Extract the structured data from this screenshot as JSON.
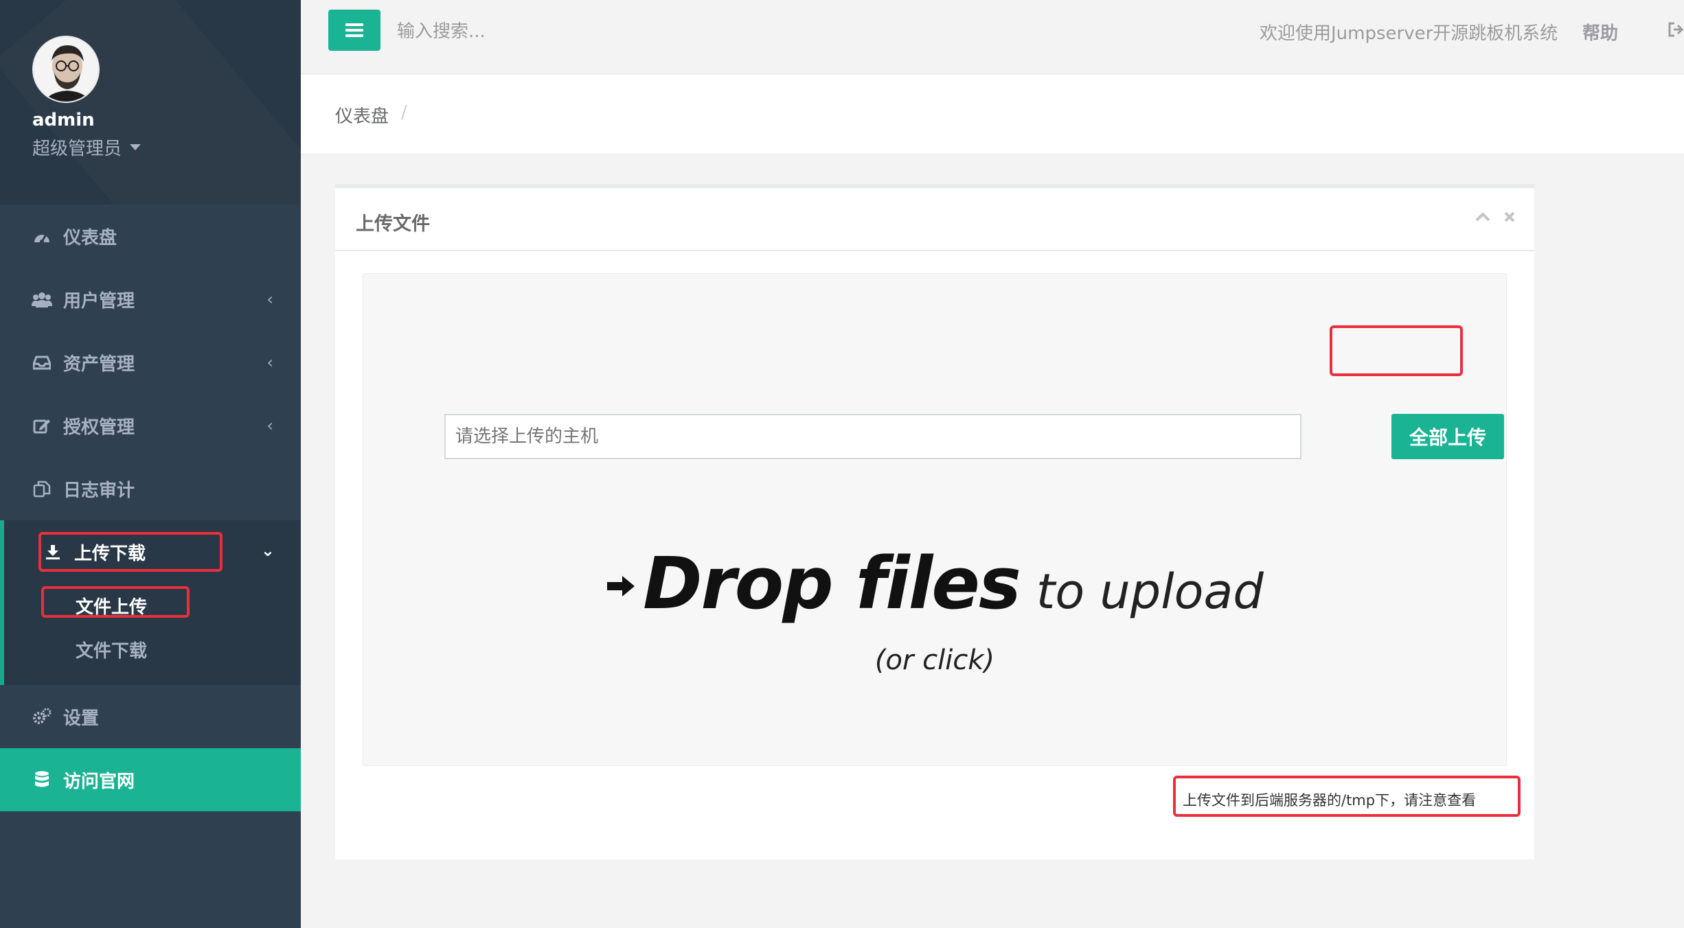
{
  "profile": {
    "name": "admin",
    "role": "超级管理员"
  },
  "nav": {
    "items": [
      {
        "label": "仪表盘",
        "icon": "dashboard-icon"
      },
      {
        "label": "用户管理",
        "icon": "users-icon"
      },
      {
        "label": "资产管理",
        "icon": "inbox-icon"
      },
      {
        "label": "授权管理",
        "icon": "edit-icon"
      },
      {
        "label": "日志审计",
        "icon": "copy-icon"
      }
    ],
    "group": {
      "label": "上传下载",
      "icon": "download-icon",
      "sub": [
        {
          "label": "文件上传"
        },
        {
          "label": "文件下载"
        }
      ]
    },
    "settings": {
      "label": "设置",
      "icon": "cogs-icon"
    },
    "site": {
      "label": "访问官网",
      "icon": "database-icon"
    }
  },
  "topbar": {
    "search_placeholder": "输入搜索...",
    "welcome": "欢迎使用Jumpserver开源跳板机系统",
    "help": "帮助"
  },
  "breadcrumb": {
    "home": "仪表盘",
    "sep": "/"
  },
  "panel": {
    "title": "上传文件",
    "host_placeholder": "请选择上传的主机",
    "upload_all": "全部上传",
    "drop_bold": "Drop files",
    "drop_light": "to upload",
    "drop_sub": "(or click)",
    "notice": "上传文件到后端服务器的/tmp下，请注意查看"
  },
  "colors": {
    "sidebar": "#2f4050",
    "accent": "#1ab394",
    "highlight": "#e8303c"
  }
}
